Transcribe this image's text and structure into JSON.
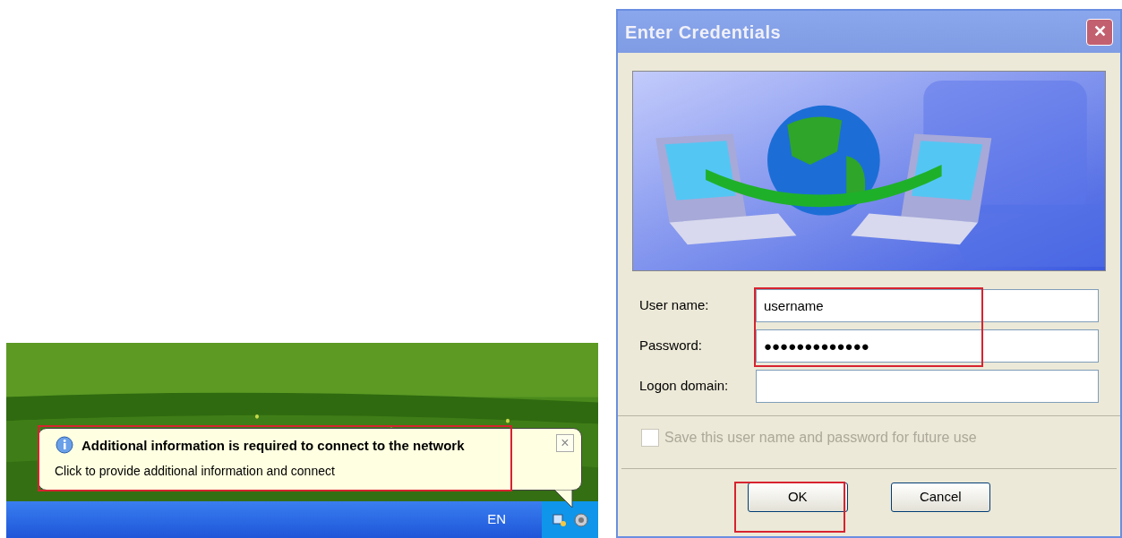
{
  "balloon": {
    "title": "Additional information is required to connect to the network",
    "message": "Click to provide additional information and connect",
    "close": "×"
  },
  "taskbar": {
    "language": "EN"
  },
  "dialog": {
    "title": "Enter Credentials",
    "close": "✕",
    "fields": [
      {
        "label": "User name:",
        "value": "username"
      },
      {
        "label": "Password:",
        "value": "●●●●●●●●●●●●●"
      },
      {
        "label": "Logon domain:"
      }
    ],
    "save_checkbox": {
      "label": "Save this user name and password for future use",
      "checked": false,
      "disabled": true
    },
    "buttons": [
      "OK",
      "Cancel"
    ]
  }
}
